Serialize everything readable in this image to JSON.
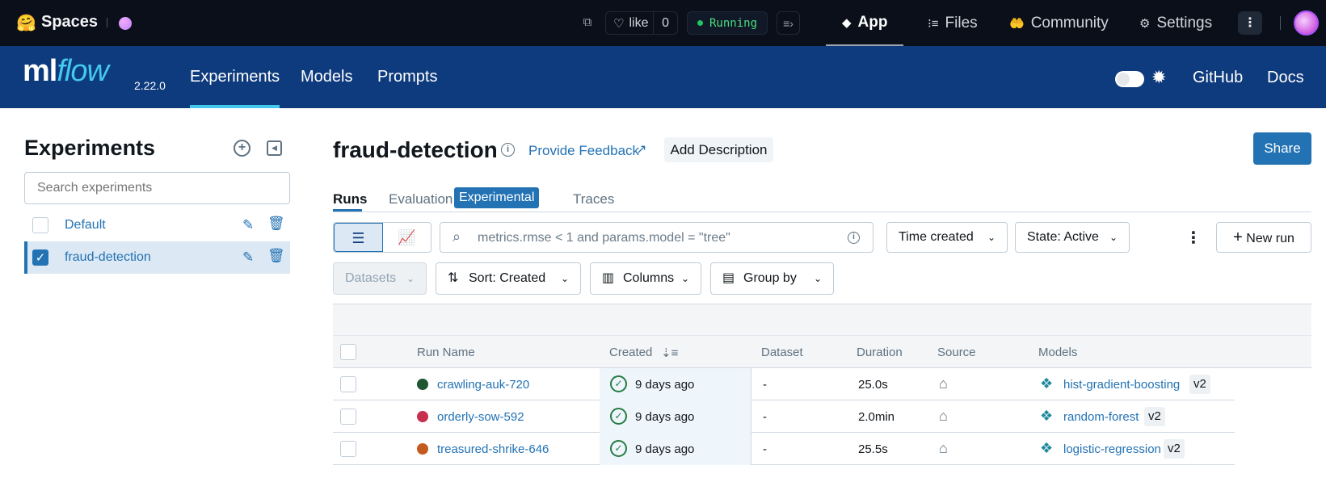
{
  "hf": {
    "title": "Spaces",
    "like_label": "like",
    "like_count": "0",
    "status": "Running",
    "nav": [
      {
        "label": "App",
        "icon": "cube-icon"
      },
      {
        "label": "Files",
        "icon": "files-icon"
      },
      {
        "label": "Community",
        "icon": "community-icon"
      },
      {
        "label": "Settings",
        "icon": "gear-icon"
      }
    ]
  },
  "mlflow": {
    "logo_ml": "ml",
    "logo_flow": "flow",
    "version": "2.22.0",
    "tabs": [
      "Experiments",
      "Models",
      "Prompts"
    ],
    "links": [
      "GitHub",
      "Docs"
    ]
  },
  "sidebar": {
    "title": "Experiments",
    "search_placeholder": "Search experiments",
    "items": [
      {
        "label": "Default",
        "selected": false
      },
      {
        "label": "fraud-detection",
        "selected": true
      }
    ]
  },
  "main": {
    "title": "fraud-detection",
    "feedback": "Provide Feedback",
    "add_description": "Add Description",
    "share": "Share",
    "tabs": {
      "runs": "Runs",
      "evaluation": "Evaluation",
      "experimental_badge": "Experimental",
      "traces": "Traces"
    },
    "search_placeholder": "metrics.rmse < 1 and params.model = \"tree\"",
    "time_created": "Time created",
    "state": "State: Active",
    "new_run": "New run",
    "datasets": "Datasets",
    "sort": "Sort: Created",
    "columns": "Columns",
    "group_by": "Group by"
  },
  "table": {
    "headers": {
      "run_name": "Run Name",
      "created": "Created",
      "dataset": "Dataset",
      "duration": "Duration",
      "source": "Source",
      "models": "Models"
    },
    "rows": [
      {
        "name": "crawling-auk-720",
        "color": "#1e5631",
        "created": "9 days ago",
        "dataset": "-",
        "duration": "25.0s",
        "model": "hist-gradient-boosting",
        "version": "v2"
      },
      {
        "name": "orderly-sow-592",
        "color": "#c8304f",
        "created": "9 days ago",
        "dataset": "-",
        "duration": "2.0min",
        "model": "random-forest",
        "version": "v2"
      },
      {
        "name": "treasured-shrike-646",
        "color": "#c55a1e",
        "created": "9 days ago",
        "dataset": "-",
        "duration": "25.5s",
        "model": "logistic-regression",
        "version": "v2"
      }
    ]
  }
}
